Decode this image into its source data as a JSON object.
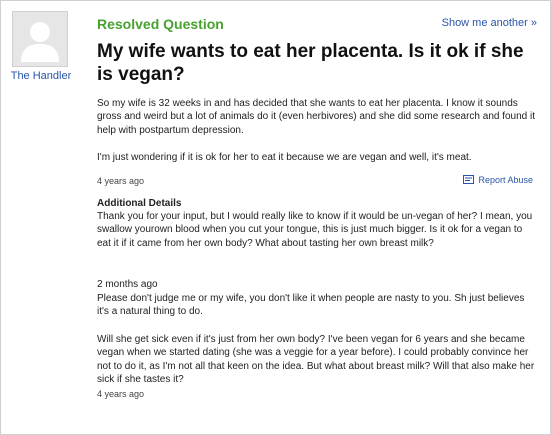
{
  "user": {
    "name": "The Handler",
    "avatar_icon": "user-silhouette-icon"
  },
  "header": {
    "status": "Resolved Question",
    "show_another": "Show me another »"
  },
  "question": {
    "title": "My wife wants to eat her placenta. Is it ok if she is vegan?",
    "body_1": "So my wife is 32 weeks in and has decided that she wants to eat her placenta. I know it sounds gross and weird but a lot of animals do it (even herbivores) and she did some research and found it help with postpartum depression.",
    "body_2": "I'm just wondering if it is ok for her to eat it because we are vegan and well, it's meat.",
    "timestamp": "4 years ago",
    "report_abuse": "Report Abuse",
    "report_icon": "flag-icon"
  },
  "additional_details": {
    "heading": "Additional Details",
    "detail_1": "Thank you for your input, but I would really like to know if it would be un-vegan of her? I mean, you swallow yourown blood when you cut your tongue, this is just much bigger. Is it ok for a vegan to eat it if it came from her own body? What about tasting her own breast milk?",
    "detail_2_time": "2 months ago",
    "detail_2": "Please don't judge me or my wife, you don't like it when people are nasty to you. Sh just believes it's a natural thing to do.",
    "detail_3": "Will she get sick even if it's just from her own body? I've been vegan for 6 years and she became vegan when we started dating (she was a veggie for a year before). I could probably convince her not to do it, as I'm not all that keen on the idea. But what about breast milk? Will that also make her sick if she tastes it?",
    "detail_3_time": "4 years ago"
  },
  "colors": {
    "resolved_green": "#48a22f",
    "link_blue": "#2a55a8"
  }
}
